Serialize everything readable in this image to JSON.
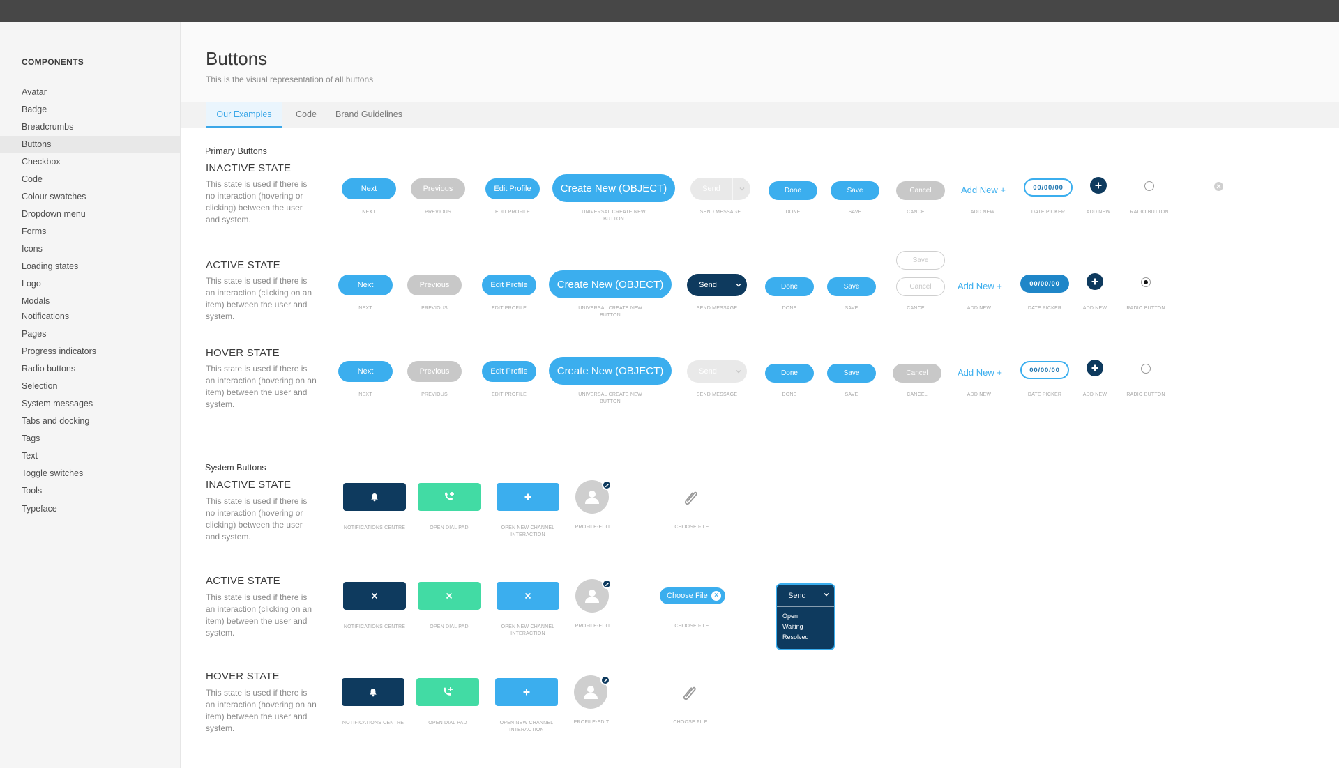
{
  "sidebar": {
    "title": "COMPONENTS",
    "items": [
      "Avatar",
      "Badge",
      "Breadcrumbs",
      "Buttons",
      "Checkbox",
      "Code",
      "Colour swatches",
      "Dropdown menu",
      "Forms",
      "Icons",
      "Loading states",
      "Logo",
      "Modals",
      "Notifications",
      "Pages",
      "Progress indicators",
      "Radio buttons",
      "Selection",
      "System messages",
      "Tabs and docking",
      "Tags",
      "Text",
      "Toggle switches",
      "Tools",
      "Typeface"
    ],
    "active_index": 3
  },
  "header": {
    "title": "Buttons",
    "subtitle": "This is the visual representation of all buttons"
  },
  "tabs": [
    "Our Examples",
    "Code",
    "Brand Guidelines"
  ],
  "primary": {
    "title": "Primary Buttons",
    "states": [
      {
        "title": "INACTIVE STATE",
        "desc": "This state is used if there is no interaction (hovering or clicking) between the user and system."
      },
      {
        "title": "ACTIVE STATE",
        "desc": "This state is used if there is an interaction (clicking on an item) between the user and system."
      },
      {
        "title": "HOVER STATE",
        "desc": "This state is used if there is an interaction (hovering on an item) between the user and system."
      }
    ],
    "labels": {
      "next": "Next",
      "previous": "Previous",
      "edit_profile": "Edit Profile",
      "create_new": "Create New (OBJECT)",
      "send": "Send",
      "done": "Done",
      "save": "Save",
      "cancel": "Cancel",
      "add_new": "Add New +",
      "date": "00/00/00"
    },
    "captions": {
      "next": "NEXT",
      "previous": "PREVIOUS",
      "edit_profile": "EDIT PROFILE",
      "create_new": "UNIVERSAL CREATE NEW BUTTON",
      "send": "SEND MESSAGE",
      "done": "DONE",
      "save": "SAVE",
      "cancel": "CANCEL",
      "add_new_text": "ADD NEW",
      "date": "DATE PICKER",
      "add_new_icon": "ADD NEW",
      "radio": "RADIO BUTTON"
    }
  },
  "system": {
    "title": "System Buttons",
    "states": [
      {
        "title": "INACTIVE STATE",
        "desc": "This state is used if there is no interaction (hovering or clicking) between the user and system."
      },
      {
        "title": "ACTIVE STATE",
        "desc": "This state is used if there is an interaction (clicking on an item) between the user and system."
      },
      {
        "title": "HOVER STATE",
        "desc": "This state is used if there is an interaction (hovering on an item) between the user and system."
      }
    ],
    "captions": {
      "notifications": "NOTIFICATIONS CENTRE",
      "dial": "OPEN DIAL PAD",
      "channel": "OPEN NEW CHANNEL INTERACTION",
      "profile": "PROFILE-EDIT",
      "file": "CHOOSE FILE"
    },
    "choose_file": "Choose File",
    "send_dropdown": {
      "label": "Send",
      "options": [
        "Open",
        "Waiting",
        "Resolved"
      ]
    }
  },
  "colors": {
    "blue": "#3baeee",
    "navy": "#0e3a5e",
    "teal": "#42dba4",
    "grey": "#c8c8c8",
    "topbar": "#474747"
  }
}
